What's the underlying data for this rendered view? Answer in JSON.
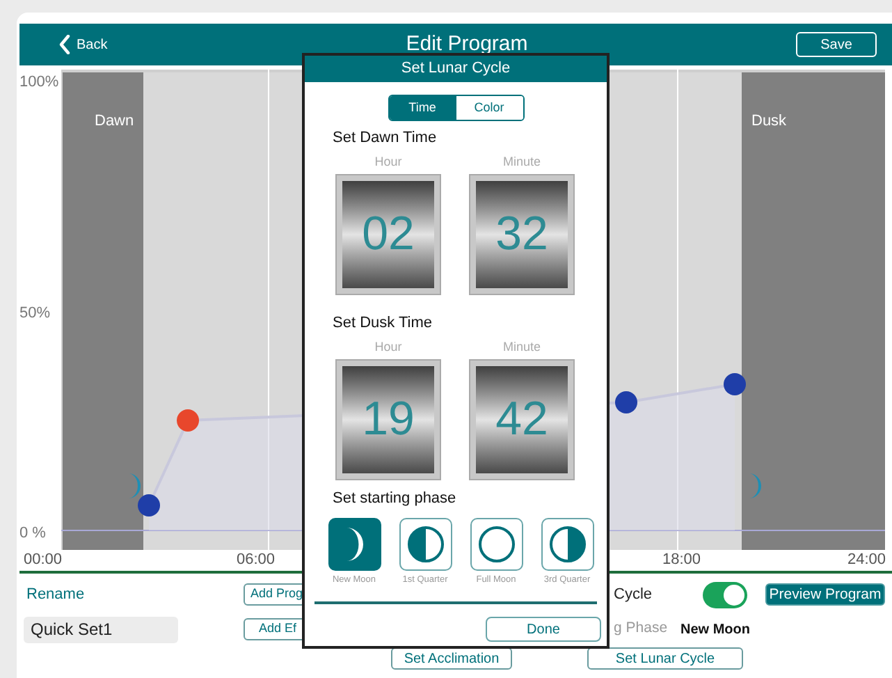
{
  "header": {
    "back": "Back",
    "title": "Edit Program",
    "save": "Save"
  },
  "chart": {
    "y_labels": [
      "100%",
      "50%",
      "0 %"
    ],
    "x_labels": [
      "00:00",
      "06:00",
      "18:00",
      "24:00"
    ],
    "bands": [
      "Dawn",
      "Dusk"
    ]
  },
  "controls": {
    "rename_label": "Rename",
    "name_value": "Quick Set1",
    "add_program": "Add Prog",
    "add_effect": "Add Ef",
    "lunar_cycle_label": "Cycle",
    "lunar_cycle_on": true,
    "phase_label": "g Phase",
    "phase_value": "New Moon",
    "preview": "Preview Program",
    "set_acclimation": "Set Acclimation",
    "set_lunar_cycle": "Set Lunar Cycle"
  },
  "dialog": {
    "title": "Set Lunar Cycle",
    "tabs": [
      {
        "label": "Time",
        "selected": true
      },
      {
        "label": "Color",
        "selected": false
      }
    ],
    "sections": [
      {
        "title": "Set Dawn Time",
        "hour_label": "Hour",
        "minute_label": "Minute",
        "hour": "02",
        "minute": "32"
      },
      {
        "title": "Set Dusk Time",
        "hour_label": "Hour",
        "minute_label": "Minute",
        "hour": "19",
        "minute": "42"
      }
    ],
    "phase_title": "Set starting phase",
    "phases": [
      {
        "kind": "new",
        "label": "New Moon",
        "selected": true
      },
      {
        "kind": "first",
        "label": "1st Quarter",
        "selected": false
      },
      {
        "kind": "full",
        "label": "Full Moon",
        "selected": false
      },
      {
        "kind": "third",
        "label": "3rd Quarter",
        "selected": false
      }
    ],
    "done": "Done"
  }
}
